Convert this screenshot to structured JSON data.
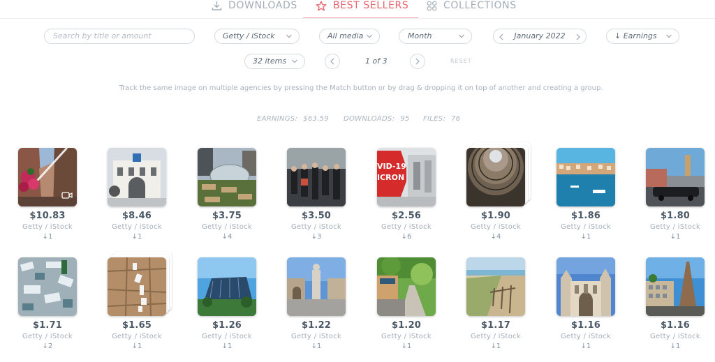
{
  "nav": {
    "tabs": [
      {
        "label": "DOWNLOADS",
        "icon": "download-icon",
        "active": false
      },
      {
        "label": "BEST SELLERS",
        "icon": "star-icon",
        "active": true
      },
      {
        "label": "COLLECTIONS",
        "icon": "grid-icon",
        "active": false
      }
    ]
  },
  "filters": {
    "search_placeholder": "Search by title or amount",
    "agency": "Getty / iStock",
    "media": "All media",
    "period": "Month",
    "month": "January 2022",
    "sort": "↓ Earnings",
    "per_page": "32 items",
    "page": "1 of 3",
    "reset": "RESET"
  },
  "hint": "Track the same image on multiple agencies by pressing the Match button or by drag & dropping it on top of another and creating a group.",
  "stats": {
    "earnings_label": "EARNINGS:",
    "earnings": "$63.59",
    "downloads_label": "DOWNLOADS:",
    "downloads": "95",
    "files_label": "FILES:",
    "files": "76"
  },
  "items": [
    {
      "price": "$10.83",
      "agency": "Getty / iStock",
      "downloads": "↓1",
      "scene": "alley-flowers",
      "video": true,
      "stacked": false
    },
    {
      "price": "$8.46",
      "agency": "Getty / iStock",
      "downloads": "↓1",
      "scene": "white-building",
      "video": false,
      "stacked": false
    },
    {
      "price": "$3.75",
      "agency": "Getty / iStock",
      "downloads": "↓4",
      "scene": "garden-dome",
      "video": false,
      "stacked": false
    },
    {
      "price": "$3.50",
      "agency": "Getty / iStock",
      "downloads": "↓3",
      "scene": "crowd-street",
      "video": false,
      "stacked": false
    },
    {
      "price": "$2.56",
      "agency": "Getty / iStock",
      "downloads": "↓6",
      "scene": "covid-sign",
      "sign_text_1": "VID-19",
      "sign_text_2": "ICRON",
      "video": false,
      "stacked": false
    },
    {
      "price": "$1.90",
      "agency": "Getty / iStock",
      "downloads": "↓4",
      "scene": "dome-archive",
      "video": false,
      "stacked": true
    },
    {
      "price": "$1.86",
      "agency": "Getty / iStock",
      "downloads": "↓1",
      "scene": "harbor",
      "video": false,
      "stacked": false
    },
    {
      "price": "$1.80",
      "agency": "Getty / iStock",
      "downloads": "↓1",
      "scene": "limo-street",
      "video": false,
      "stacked": false
    },
    {
      "price": "$1.71",
      "agency": "Getty / iStock",
      "downloads": "↓2",
      "scene": "plastic-waste",
      "video": false,
      "stacked": false
    },
    {
      "price": "$1.65",
      "agency": "Getty / iStock",
      "downloads": "↓1",
      "scene": "wall-notes",
      "video": false,
      "stacked": true
    },
    {
      "price": "$1.26",
      "agency": "Getty / iStock",
      "downloads": "↓1",
      "scene": "glass-building",
      "video": false,
      "stacked": false
    },
    {
      "price": "$1.22",
      "agency": "Getty / iStock",
      "downloads": "↓1",
      "scene": "plaza-statue",
      "video": false,
      "stacked": false
    },
    {
      "price": "$1.20",
      "agency": "Getty / iStock",
      "downloads": "↓1",
      "scene": "green-street",
      "video": false,
      "stacked": false
    },
    {
      "price": "$1.17",
      "agency": "Getty / iStock",
      "downloads": "↓1",
      "scene": "beach-fence",
      "video": false,
      "stacked": false
    },
    {
      "price": "$1.16",
      "agency": "Getty / iStock",
      "downloads": "↓1",
      "scene": "gothic-court",
      "video": false,
      "stacked": false
    },
    {
      "price": "$1.16",
      "agency": "Getty / iStock",
      "downloads": "↓1",
      "scene": "eiffel-vegas",
      "video": false,
      "stacked": false
    }
  ]
}
